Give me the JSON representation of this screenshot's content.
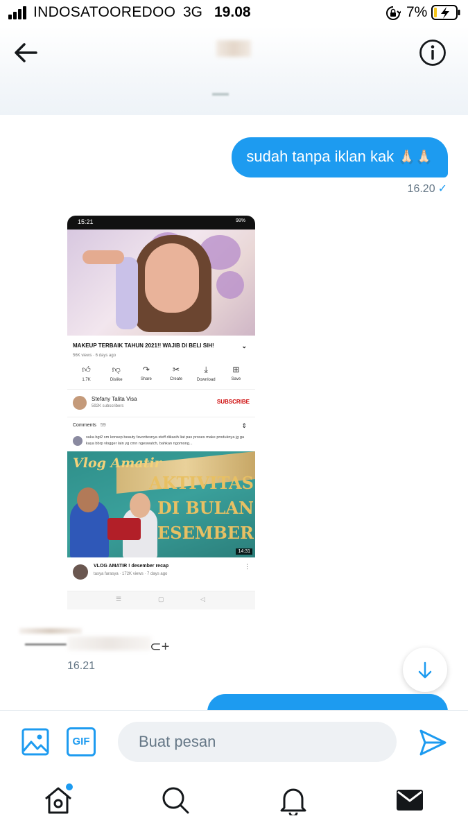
{
  "status_bar": {
    "carrier": "INDOSATOOREDOO",
    "network": "3G",
    "time": "19.08",
    "battery_percent": "7%"
  },
  "colors": {
    "accent": "#1d9bf0",
    "muted_text": "#657786"
  },
  "messages": {
    "outgoing_1": {
      "text": "sudah tanpa iklan kak",
      "emoji": "🙏🏻🙏🏻",
      "time": "16.20",
      "status_icon": "check-icon"
    },
    "incoming_time": "16.21",
    "partial_outgoing_visible": true
  },
  "attachment": {
    "status_time": "15:21",
    "status_right": "98%",
    "video_title": "MAKEUP TERBAIK TAHUN 2021!! WAJIB DI BELI SIH!",
    "video_meta": "56K views · 6 days ago",
    "actions": [
      {
        "icon": "like-icon",
        "label": "1.7K"
      },
      {
        "icon": "dislike-icon",
        "label": "Dislike"
      },
      {
        "icon": "share-icon",
        "label": "Share"
      },
      {
        "icon": "create-icon",
        "label": "Create"
      },
      {
        "icon": "download-icon",
        "label": "Download"
      },
      {
        "icon": "save-icon",
        "label": "Save"
      }
    ],
    "channel_name": "Stefany Talita Visa",
    "channel_subs": "592K subscribers",
    "subscribe_label": "SUBSCRIBE",
    "comments_label": "Comments",
    "comments_count": "59",
    "comment_text": "suka bgt2 sm konsep beauty favoritesnya steff dikasih liat pas proses make produknya jg ga kaya bbrp vlogger lain yg cmn ngeswatch, bahkan ngomong...",
    "vlog_script": "Vlog Amatir",
    "vlog_lines": [
      "AKTIVITAS",
      "DI BULAN",
      "DESEMBER"
    ],
    "vlog_duration": "14:31",
    "next_title": "VLOG AMATIR ! desember recap",
    "next_meta": "tasya farasya · 172K views · 7 days ago"
  },
  "composer": {
    "placeholder": "Buat pesan",
    "gif_label": "GIF"
  },
  "tabs": [
    {
      "name": "home",
      "icon": "home-icon",
      "has_notification": true
    },
    {
      "name": "search",
      "icon": "search-icon",
      "has_notification": false
    },
    {
      "name": "notifications",
      "icon": "bell-icon",
      "has_notification": false
    },
    {
      "name": "messages",
      "icon": "envelope-icon",
      "has_notification": false
    }
  ]
}
